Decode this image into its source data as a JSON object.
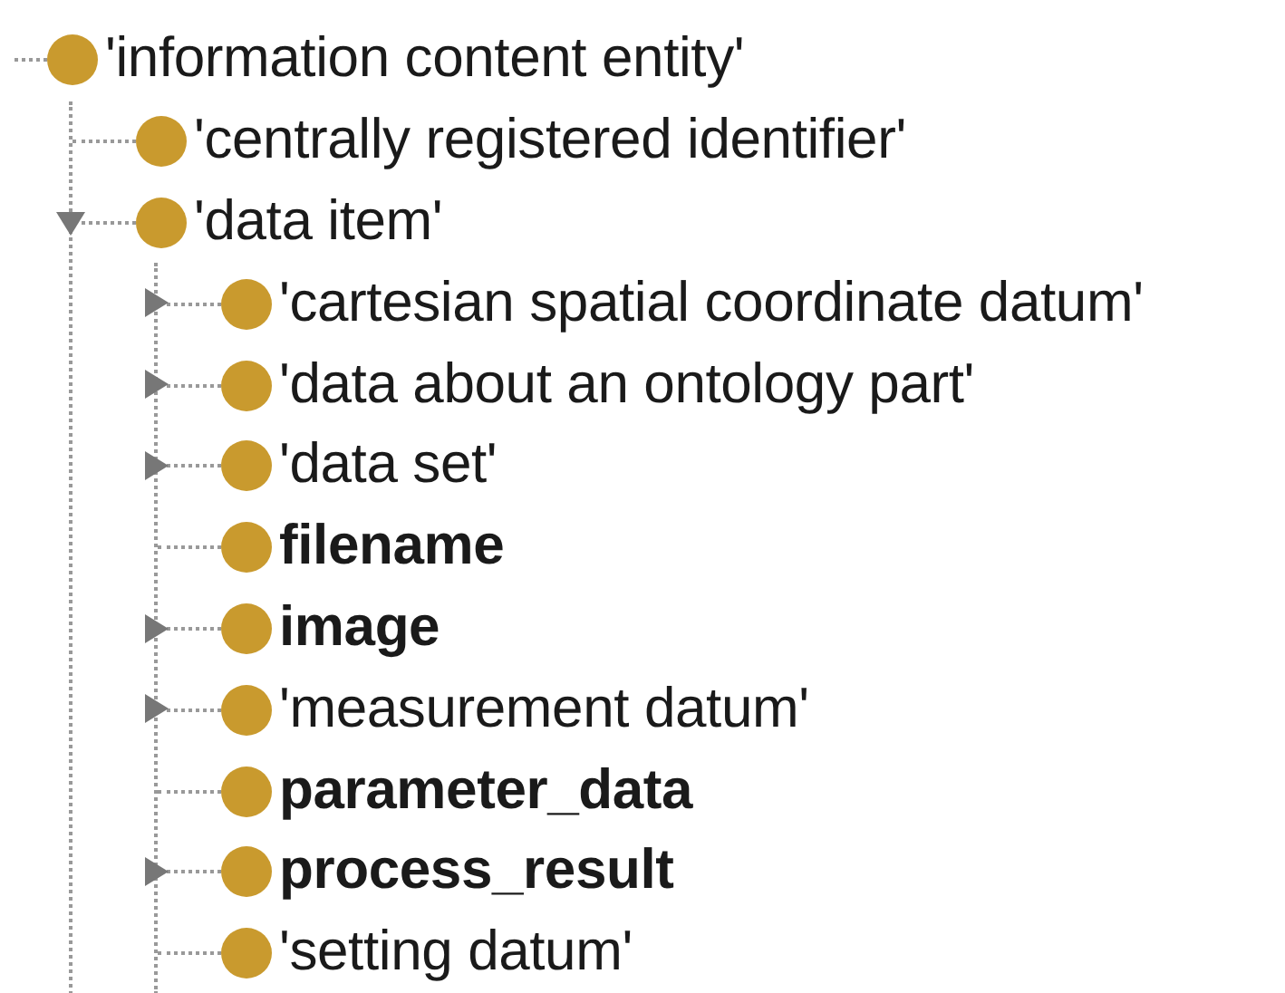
{
  "tree": [
    {
      "label": "'information content entity'",
      "bold": false,
      "kind": "root",
      "children": [
        {
          "label": "'centrally registered identifier'",
          "bold": false,
          "kind": "leaf"
        },
        {
          "label": "'data item'",
          "bold": false,
          "kind": "branch",
          "expanded": true,
          "children": [
            {
              "label": "'cartesian spatial coordinate datum'",
              "bold": false,
              "kind": "branch",
              "expanded": false
            },
            {
              "label": "'data about an ontology part'",
              "bold": false,
              "kind": "branch",
              "expanded": false
            },
            {
              "label": "'data set'",
              "bold": false,
              "kind": "branch",
              "expanded": false
            },
            {
              "label": "filename",
              "bold": true,
              "kind": "leaf"
            },
            {
              "label": "image",
              "bold": true,
              "kind": "branch",
              "expanded": false
            },
            {
              "label": "'measurement datum'",
              "bold": false,
              "kind": "branch",
              "expanded": false
            },
            {
              "label": "parameter_data",
              "bold": true,
              "kind": "leaf"
            },
            {
              "label": "process_result",
              "bold": true,
              "kind": "branch",
              "expanded": false
            },
            {
              "label": "'setting datum'",
              "bold": false,
              "kind": "leaf"
            }
          ]
        }
      ]
    }
  ]
}
